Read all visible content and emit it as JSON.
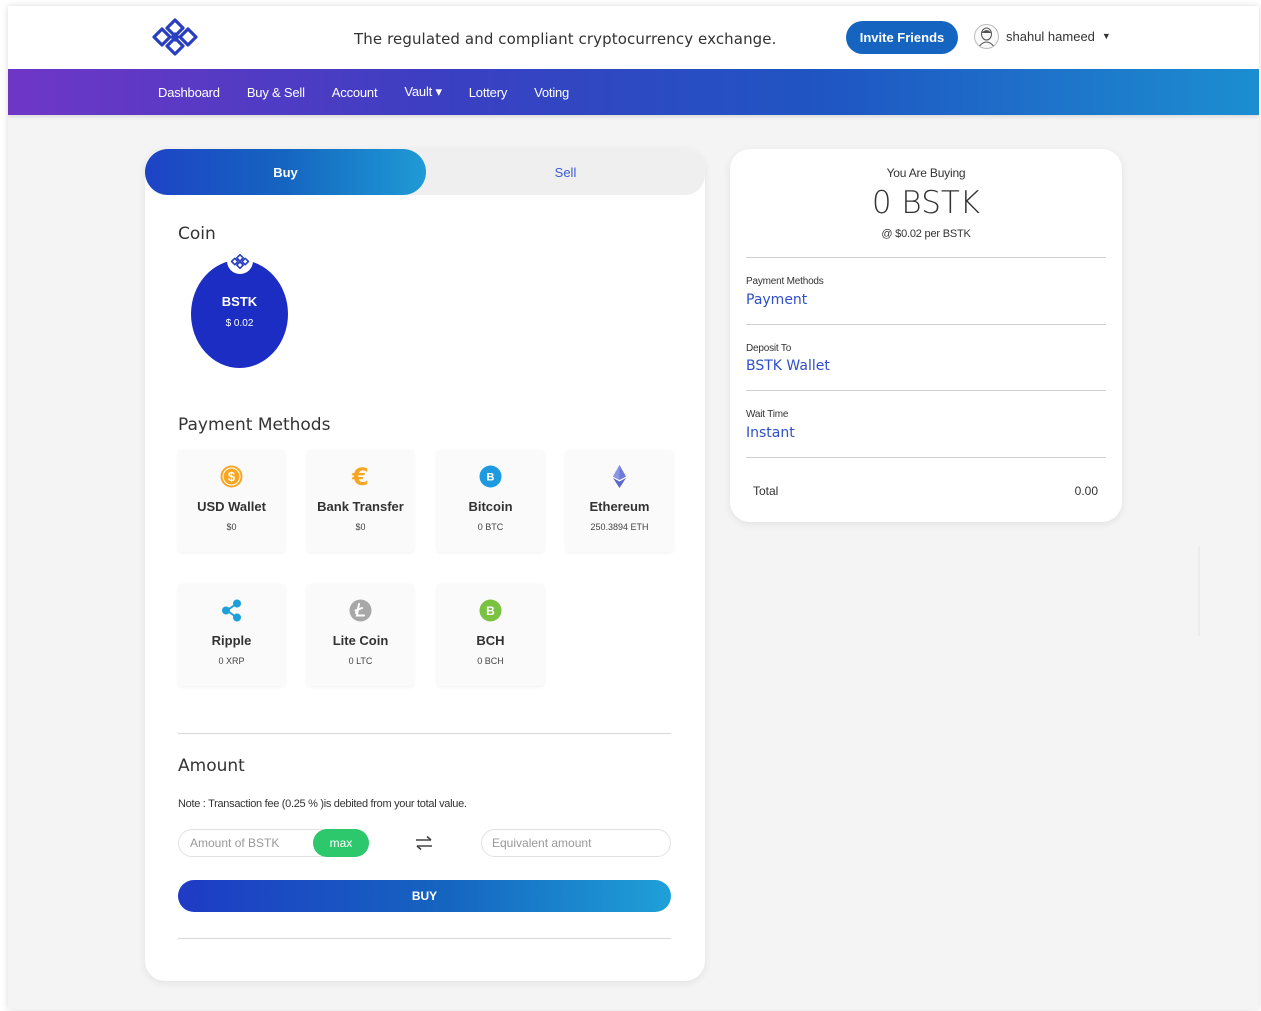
{
  "header": {
    "tagline": "The regulated and compliant cryptocurrency exchange.",
    "invite_label": "Invite Friends",
    "user_name": "shahul hameed"
  },
  "nav": {
    "items": [
      "Dashboard",
      "Buy & Sell",
      "Account",
      "Vault ▾",
      "Lottery",
      "Voting"
    ]
  },
  "tabs": {
    "buy": "Buy",
    "sell": "Sell"
  },
  "coin": {
    "title": "Coin",
    "name": "BSTK",
    "price": "$ 0.02"
  },
  "payment_methods": {
    "title": "Payment Methods",
    "items": [
      {
        "name": "USD Wallet",
        "balance": "$0",
        "icon": "dollar-coin-icon",
        "color": "#f6a623"
      },
      {
        "name": "Bank Transfer",
        "balance": "$0",
        "icon": "euro-icon",
        "color": "#f5a623"
      },
      {
        "name": "Bitcoin",
        "balance": "0 BTC",
        "icon": "bitcoin-icon",
        "color": "#1e9be0"
      },
      {
        "name": "Ethereum",
        "balance": "250.3894 ETH",
        "icon": "ethereum-icon",
        "color": "#6c7bd8"
      },
      {
        "name": "Ripple",
        "balance": "0 XRP",
        "icon": "ripple-icon",
        "color": "#1f9fd8"
      },
      {
        "name": "Lite Coin",
        "balance": "0 LTC",
        "icon": "litecoin-icon",
        "color": "#a8a8a8"
      },
      {
        "name": "BCH",
        "balance": "0 BCH",
        "icon": "bitcoin-cash-icon",
        "color": "#7cc242"
      }
    ]
  },
  "amount": {
    "title": "Amount",
    "note": "Note : Transaction fee (0.25 % )is debited from your total value.",
    "bstk_placeholder": "Amount of BSTK",
    "max_label": "max",
    "equiv_placeholder": "Equivalent amount",
    "buy_label": "BUY"
  },
  "summary": {
    "label": "You Are Buying",
    "amount": "0 BSTK",
    "rate": "@ $0.02 per BSTK",
    "payment_label": "Payment Methods",
    "payment_value": "Payment",
    "deposit_label": "Deposit To",
    "deposit_value": "BSTK Wallet",
    "wait_label": "Wait Time",
    "wait_value": "Instant",
    "total_label": "Total",
    "total_value": "0.00"
  },
  "colors": {
    "brand_blue": "#1565c0",
    "accent_green": "#2dc86b",
    "link_blue": "#2f4fc8",
    "coin_blue": "#1b2dc2"
  }
}
